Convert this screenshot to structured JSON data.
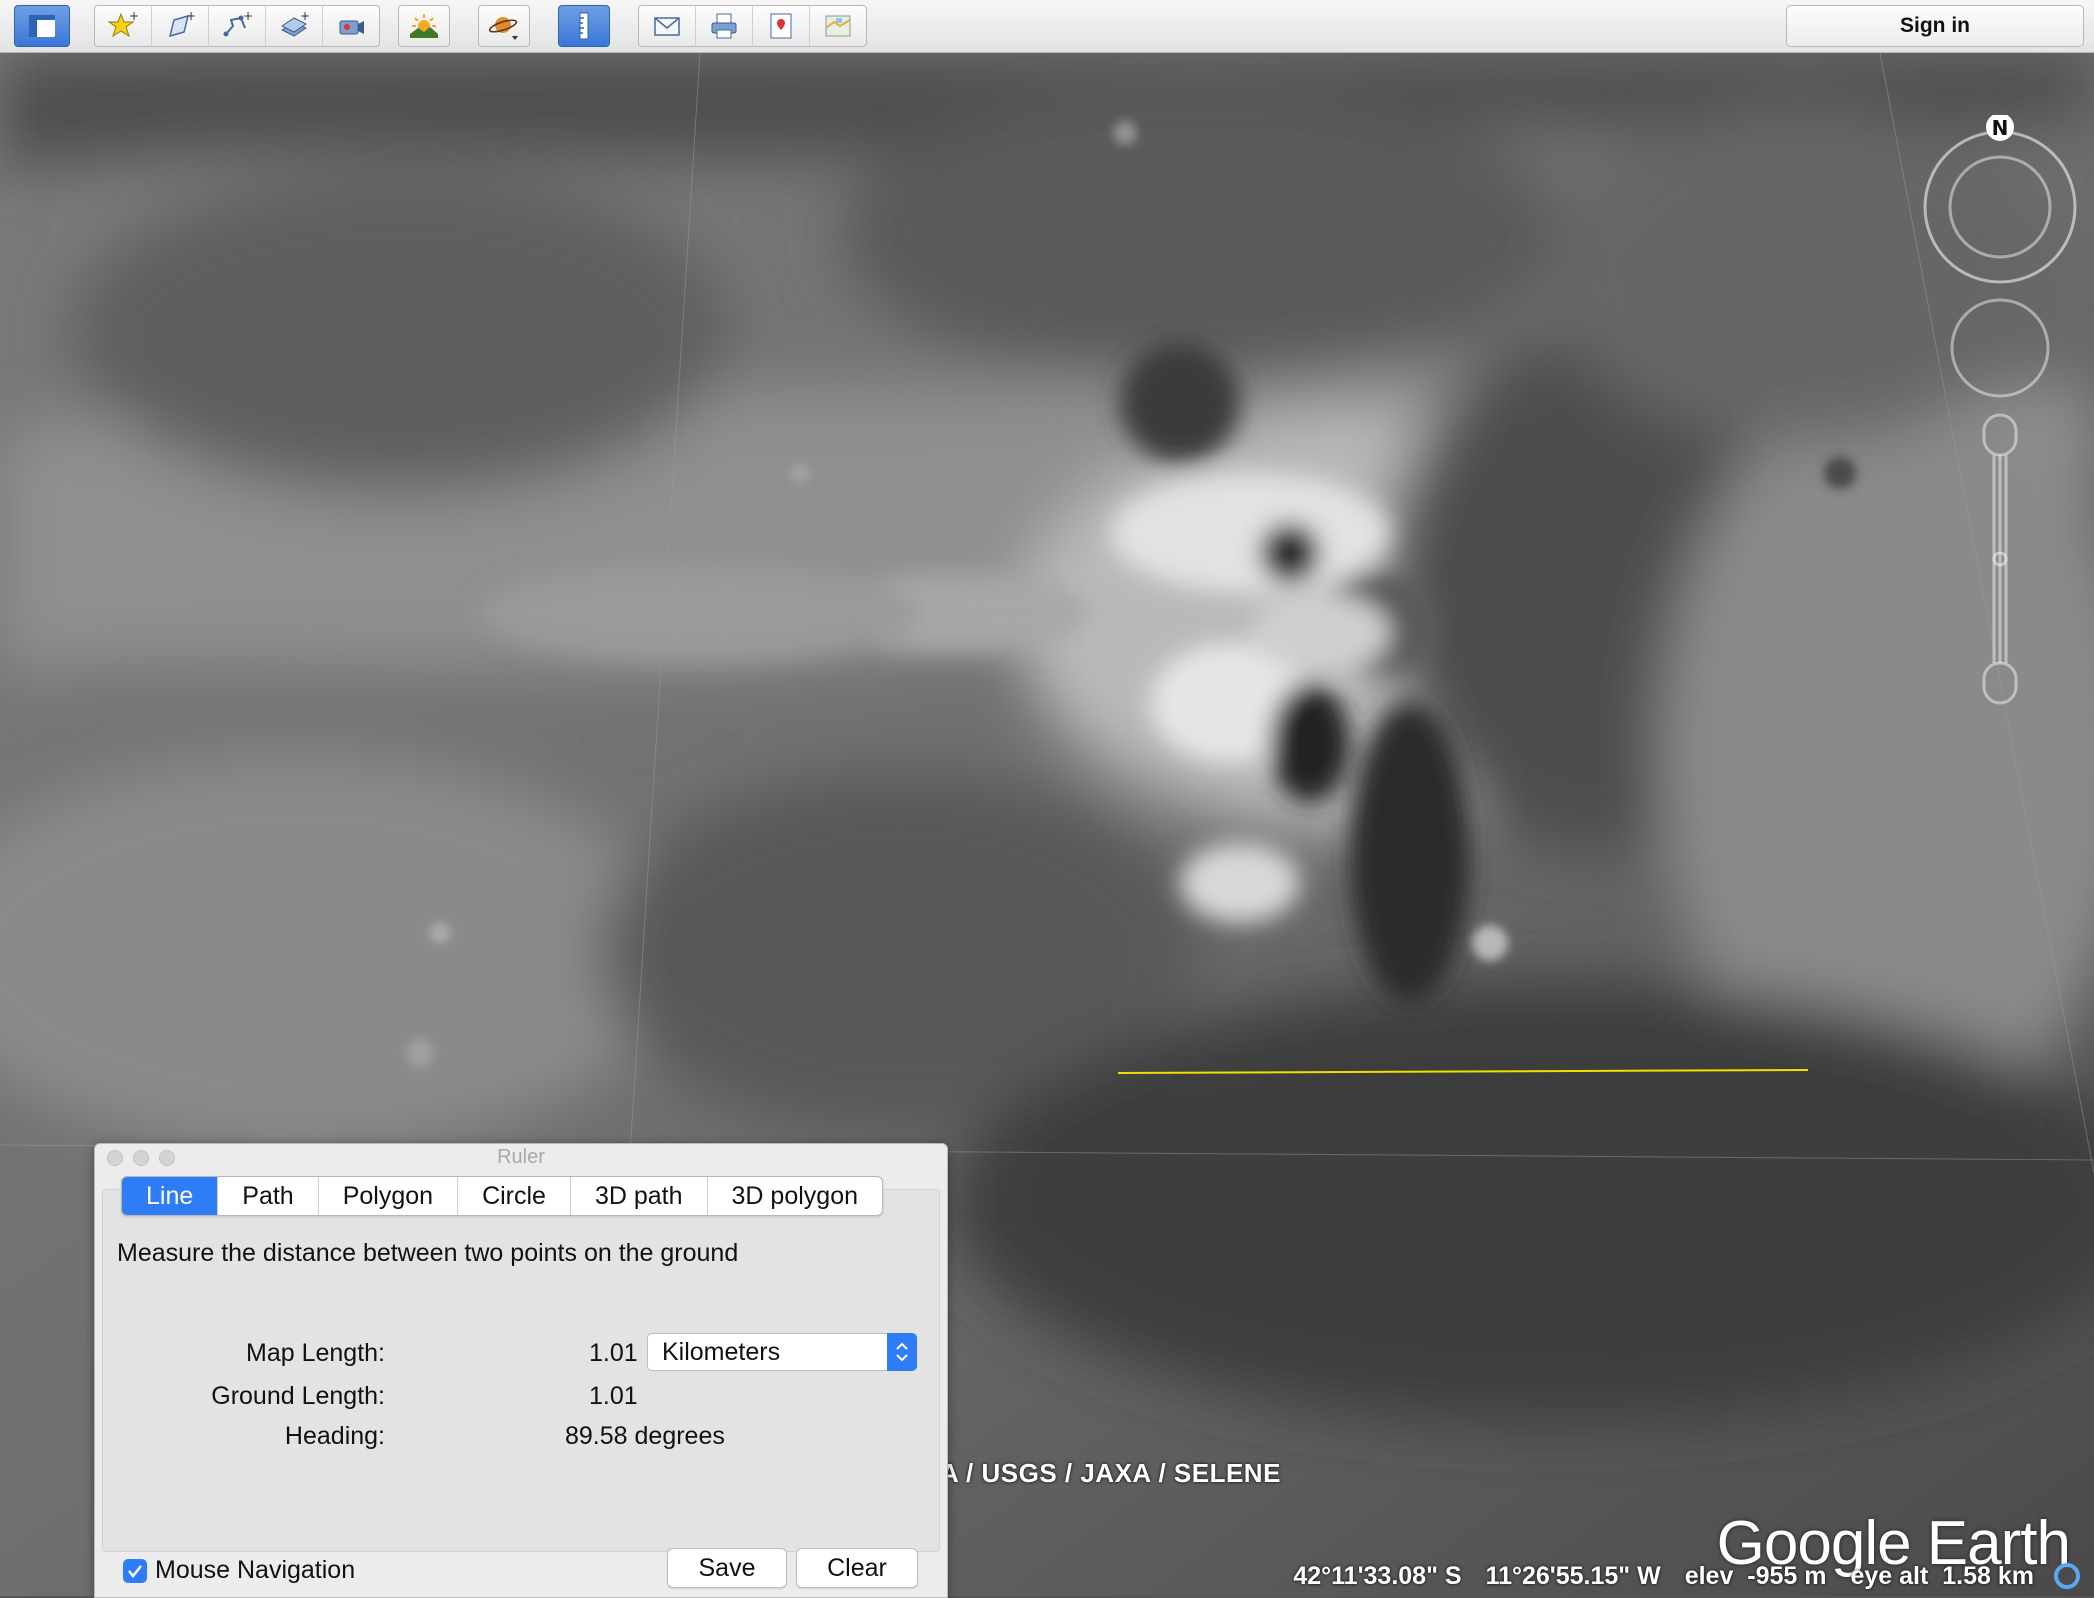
{
  "toolbar": {
    "icons": [
      "sidebar-icon",
      "add-placemark-icon",
      "add-polygon-icon",
      "add-path-icon",
      "add-image-overlay-icon",
      "record-tour-icon",
      "sunlight-icon",
      "planets-icon",
      "ruler-icon",
      "email-icon",
      "print-icon",
      "save-image-icon",
      "view-in-maps-icon"
    ],
    "signin_label": "Sign in"
  },
  "map": {
    "north_label": "N",
    "credits": "A / USGS / JAXA / SELENE",
    "logo": "Google Earth",
    "status": {
      "lat": "42°11'33.08\" S",
      "lon": "11°26'55.15\" W",
      "elev_label": "elev",
      "elev_value": "-955 m",
      "eye_label": "eye alt",
      "eye_value": "1.58 km"
    },
    "measure_line_color": "#f0e000"
  },
  "ruler": {
    "title": "Ruler",
    "tabs": [
      "Line",
      "Path",
      "Polygon",
      "Circle",
      "3D path",
      "3D polygon"
    ],
    "active_tab": "Line",
    "description": "Measure the distance between two points on the ground",
    "map_length_label": "Map Length:",
    "map_length_value": "1.01",
    "unit": "Kilometers",
    "ground_length_label": "Ground Length:",
    "ground_length_value": "1.01",
    "heading_label": "Heading:",
    "heading_value": "89.58 degrees",
    "mouse_nav_label": "Mouse Navigation",
    "mouse_nav_checked": true,
    "save_label": "Save",
    "clear_label": "Clear"
  }
}
